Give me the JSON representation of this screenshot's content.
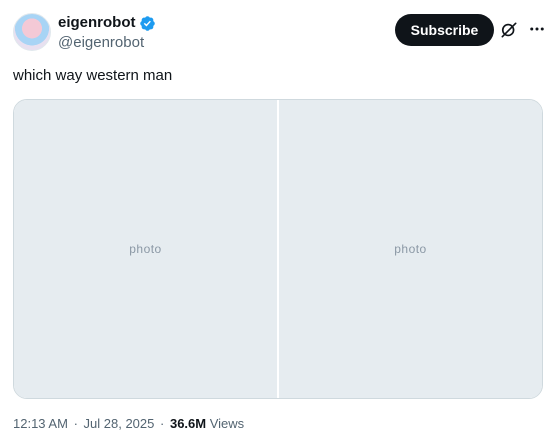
{
  "author": {
    "name": "eigenrobot",
    "handle": "@eigenrobot",
    "verified_color": "#1d9bf0"
  },
  "actions": {
    "subscribe_label": "Subscribe",
    "grok_icon": "grok-icon",
    "more_icon": "more-icon"
  },
  "tweet": {
    "text": "which way western man"
  },
  "media": {
    "placeholder_label": "photo"
  },
  "meta": {
    "time": "12:13 AM",
    "separator": "·",
    "date": "Jul 28, 2025",
    "views_count": "36.6M",
    "views_label": "Views"
  }
}
